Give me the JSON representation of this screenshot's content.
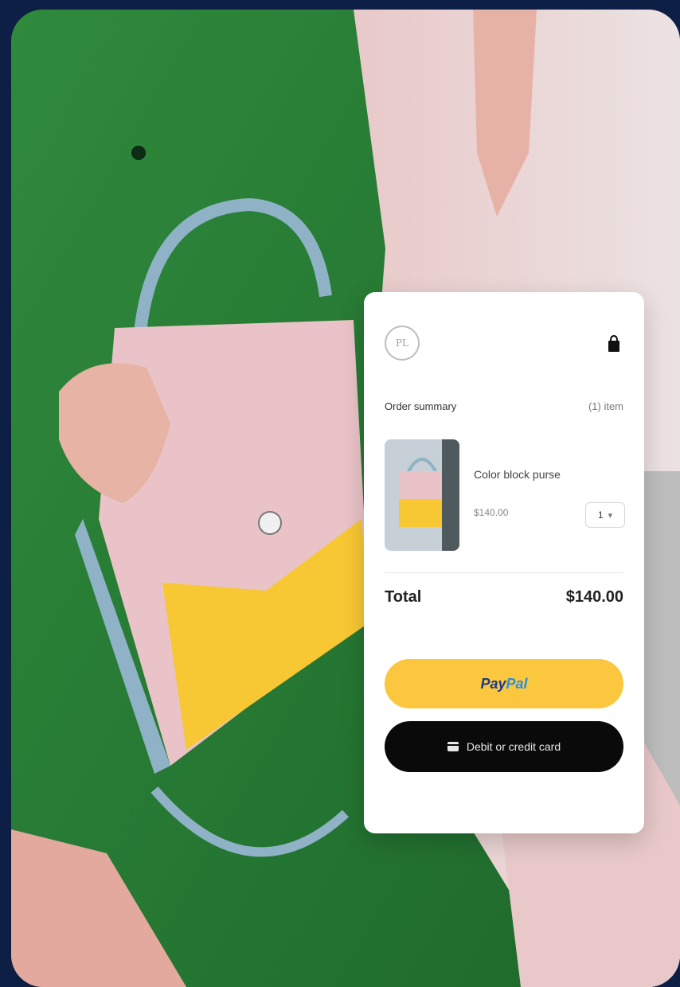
{
  "checkout": {
    "logo_text": "PL",
    "summary_title": "Order summary",
    "item_count": "(1) item",
    "item": {
      "name": "Color block purse",
      "price": "$140.00",
      "quantity": "1"
    },
    "total_label": "Total",
    "total_value": "$140.00",
    "paypal_pay": "Pay",
    "paypal_pal": "Pal",
    "card_button": "Debit or credit card"
  },
  "colors": {
    "background": "#0d1f45",
    "paypal_yellow": "#fbc73e",
    "card_button_black": "#0a0a0a"
  }
}
